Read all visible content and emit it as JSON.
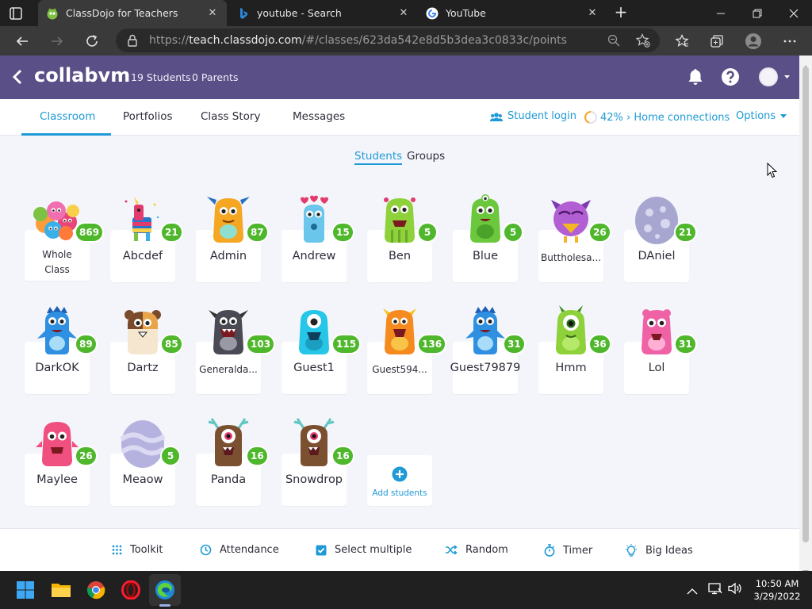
{
  "browser": {
    "tabs": [
      {
        "title": "ClassDojo for Teachers",
        "active": true
      },
      {
        "title": "youtube - Search",
        "active": false
      },
      {
        "title": "YouTube",
        "active": false
      }
    ],
    "url_prefix": "https://",
    "url_host": "teach.classdojo.com",
    "url_path": "/#/classes/623da542e8d5b3dea3c0833c/points"
  },
  "header": {
    "class_name": "collabvm",
    "students_count": "19 Students",
    "parents_count": "0 Parents"
  },
  "subnav": {
    "tabs": [
      "Classroom",
      "Portfolios",
      "Class Story",
      "Messages"
    ],
    "student_login": "Student login",
    "home_connections": "42% › Home connections",
    "options": "Options"
  },
  "view_toggle": {
    "students": "Students",
    "groups": "Groups"
  },
  "students": [
    {
      "name": "Whole Class",
      "points": "869",
      "avatar": "group"
    },
    {
      "name": "Abcdef",
      "points": "21",
      "avatar": "pinata"
    },
    {
      "name": "Admin",
      "points": "87",
      "avatar": "orange-horned"
    },
    {
      "name": "Andrew",
      "points": "15",
      "avatar": "blue-hearts"
    },
    {
      "name": "Ben",
      "points": "5",
      "avatar": "green-stripes"
    },
    {
      "name": "Blue",
      "points": "5",
      "avatar": "green-three-eyes"
    },
    {
      "name": "Buttholesa...",
      "points": "26",
      "avatar": "purple-bird"
    },
    {
      "name": "DAniel",
      "points": "21",
      "avatar": "egg-purple"
    },
    {
      "name": "DarkOK",
      "points": "89",
      "avatar": "blue-spiky"
    },
    {
      "name": "Dartz",
      "points": "85",
      "avatar": "hamster"
    },
    {
      "name": "Generalda...",
      "points": "103",
      "avatar": "grey-monster"
    },
    {
      "name": "Guest1",
      "points": "115",
      "avatar": "cyan-monster"
    },
    {
      "name": "Guest594...",
      "points": "136",
      "avatar": "orange-monster"
    },
    {
      "name": "Guest79879",
      "points": "31",
      "avatar": "blue-spiky"
    },
    {
      "name": "Hmm",
      "points": "36",
      "avatar": "green-cyclops"
    },
    {
      "name": "Lol",
      "points": "31",
      "avatar": "pink-monster"
    },
    {
      "name": "Maylee",
      "points": "26",
      "avatar": "pink-fuzzy"
    },
    {
      "name": "Meaow",
      "points": "5",
      "avatar": "egg-purple-stripes"
    },
    {
      "name": "Panda",
      "points": "16",
      "avatar": "brown-cyclops"
    },
    {
      "name": "Snowdrop",
      "points": "16",
      "avatar": "brown-cyclops"
    }
  ],
  "add_students": "Add students",
  "toolbar": {
    "toolkit": "Toolkit",
    "attendance": "Attendance",
    "select_multiple": "Select multiple",
    "random": "Random",
    "timer": "Timer",
    "big_ideas": "Big Ideas"
  },
  "taskbar": {
    "time": "10:50 AM",
    "date": "3/29/2022"
  },
  "colors": {
    "header_bg": "#5a4f86",
    "accent": "#1f9ad6",
    "badge_green": "#4fb72b",
    "content_bg": "#f4f5fa"
  }
}
